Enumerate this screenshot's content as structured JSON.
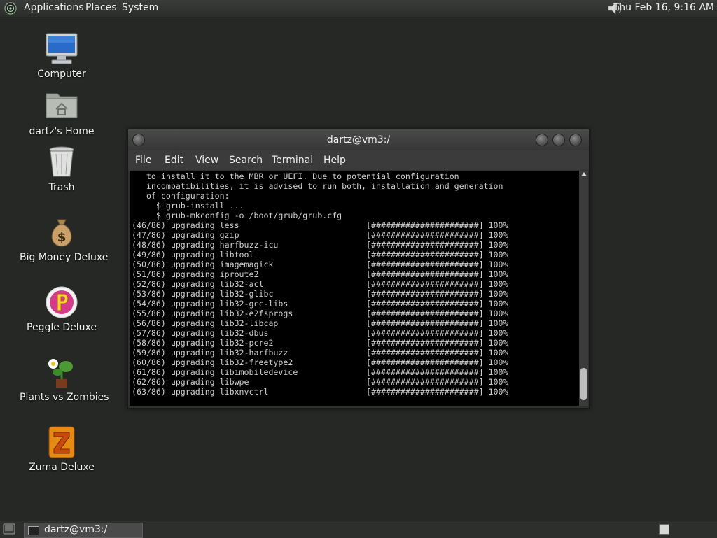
{
  "top_panel": {
    "menus": [
      "Applications",
      "Places",
      "System"
    ],
    "clock": "Thu Feb 16, 9:16 AM"
  },
  "desktop_icons": [
    {
      "label": "Computer",
      "icon": "computer-icon"
    },
    {
      "label": "dartz's Home",
      "icon": "home-folder-icon"
    },
    {
      "label": "Trash",
      "icon": "trash-icon"
    },
    {
      "label": "Big Money Deluxe",
      "icon": "money-bag-icon"
    },
    {
      "label": "Peggle Deluxe",
      "icon": "peggle-icon"
    },
    {
      "label": "Plants vs Zombies",
      "icon": "plants-vs-zombies-icon"
    },
    {
      "label": "Zuma Deluxe",
      "icon": "zuma-icon"
    }
  ],
  "terminal": {
    "title": "dartz@vm3:/",
    "menu": [
      "File",
      "Edit",
      "View",
      "Search",
      "Terminal",
      "Help"
    ],
    "lines": [
      "   to install it to the MBR or UEFI. Due to potential configuration",
      "   incompatibilities, it is advised to run both, installation and generation",
      "   of configuration:",
      "     $ grub-install ...",
      "     $ grub-mkconfig -o /boot/grub/grub.cfg",
      "(46/86) upgrading less                          [######################] 100%",
      "(47/86) upgrading gzip                          [######################] 100%",
      "(48/86) upgrading harfbuzz-icu                  [######################] 100%",
      "(49/86) upgrading libtool                       [######################] 100%",
      "(50/86) upgrading imagemagick                   [######################] 100%",
      "(51/86) upgrading iproute2                      [######################] 100%",
      "(52/86) upgrading lib32-acl                     [######################] 100%",
      "(53/86) upgrading lib32-glibc                   [######################] 100%",
      "(54/86) upgrading lib32-gcc-libs                [######################] 100%",
      "(55/86) upgrading lib32-e2fsprogs               [######################] 100%",
      "(56/86) upgrading lib32-libcap                  [######################] 100%",
      "(57/86) upgrading lib32-dbus                    [######################] 100%",
      "(58/86) upgrading lib32-pcre2                   [######################] 100%",
      "(59/86) upgrading lib32-harfbuzz                [######################] 100%",
      "(60/86) upgrading lib32-freetype2               [######################] 100%",
      "(61/86) upgrading libimobiledevice              [######################] 100%",
      "(62/86) upgrading libwpe                        [######################] 100%",
      "(63/86) upgrading libxnvctrl                    [######################] 100%"
    ]
  },
  "taskbar": {
    "task_label": "dartz@vm3:/"
  }
}
